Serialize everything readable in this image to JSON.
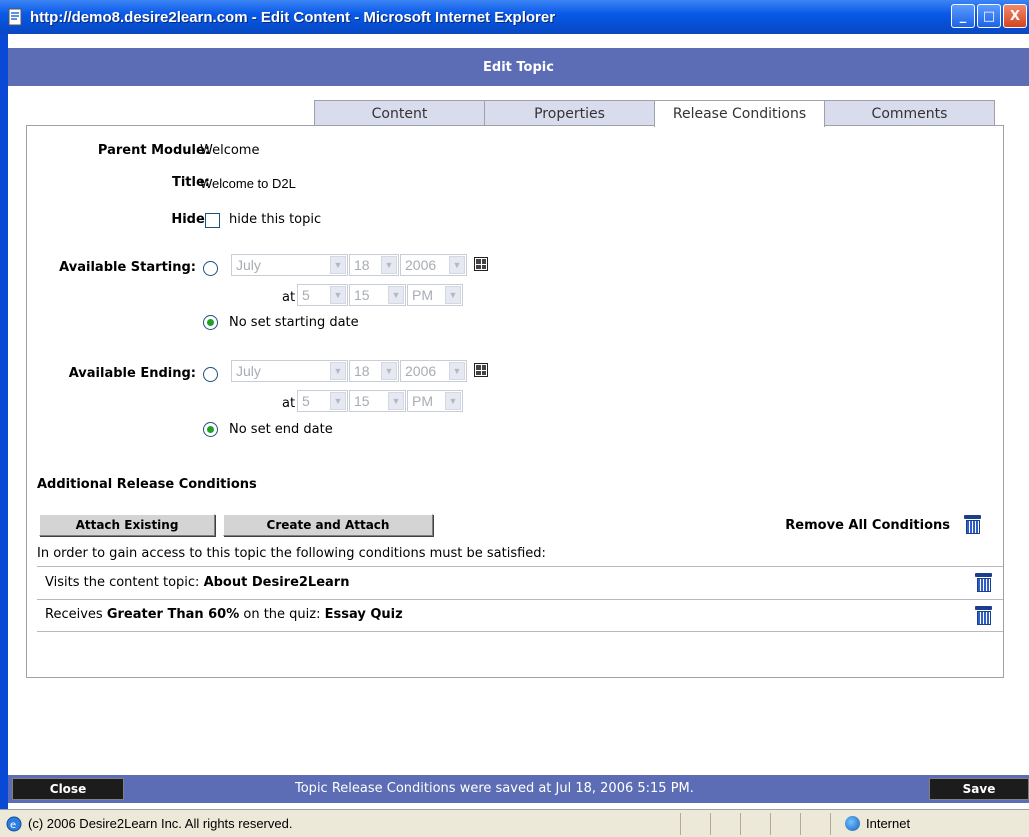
{
  "window": {
    "title": "http://demo8.desire2learn.com - Edit Content - Microsoft Internet Explorer",
    "minimize_label": "_",
    "maximize_label": "□",
    "close_label": "X"
  },
  "header": {
    "title": "Edit Topic"
  },
  "tabs": [
    {
      "label": "Content"
    },
    {
      "label": "Properties"
    },
    {
      "label": "Release Conditions"
    },
    {
      "label": "Comments"
    }
  ],
  "form": {
    "parent_module_label": "Parent Module:",
    "parent_module_value": "Welcome",
    "title_label": "Title:",
    "title_value": "Welcome to D2L",
    "hide_label": "Hide:",
    "hide_checkbox_label": "hide this topic",
    "available_starting_label": "Available Starting:",
    "available_ending_label": "Available Ending:",
    "at_label": "at",
    "start": {
      "month": "July",
      "day": "18",
      "year": "2006",
      "hour": "5",
      "minute": "15",
      "ampm": "PM",
      "no_date_label": "No set starting date"
    },
    "end": {
      "month": "July",
      "day": "18",
      "year": "2006",
      "hour": "5",
      "minute": "15",
      "ampm": "PM",
      "no_date_label": "No set end date"
    }
  },
  "conditions": {
    "heading": "Additional Release Conditions",
    "attach_existing_label": "Attach Existing",
    "create_attach_label": "Create and Attach",
    "remove_all_label": "Remove All Conditions",
    "intro": "In order to gain access to this topic the following conditions must be satisfied:",
    "row1": {
      "prefix": "Visits the content topic: ",
      "target": "About Desire2Learn"
    },
    "row2": {
      "prefix": "Receives ",
      "emph": "Greater Than 60%",
      "middle": " on the quiz: ",
      "target": "Essay Quiz"
    }
  },
  "footer": {
    "close_label": "Close",
    "save_label": "Save",
    "status": "Topic Release Conditions were saved at Jul 18, 2006 5:15 PM."
  },
  "ie_status": {
    "copyright": "(c) 2006 Desire2Learn Inc. All rights reserved.",
    "zone": "Internet"
  }
}
